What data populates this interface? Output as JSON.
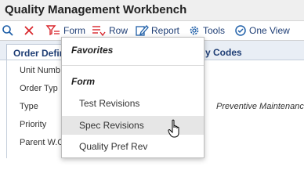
{
  "window": {
    "title": "Quality Management Workbench"
  },
  "toolbar": {
    "search_icon": "search-icon",
    "close_icon": "close-icon",
    "form": {
      "label": "Form",
      "icon": "form-filter-icon"
    },
    "row": {
      "label": "Row",
      "icon": "row-list-icon"
    },
    "report": {
      "label": "Report",
      "icon": "report-edit-icon"
    },
    "tools": {
      "label": "Tools",
      "icon": "gear-icon"
    },
    "oneview": {
      "label": "One View",
      "icon": "one-view-icon"
    }
  },
  "tabs": {
    "active": "Order Defini",
    "other": "y Codes"
  },
  "fields": {
    "unit_number": "Unit Numb",
    "order_type": "Order Typ",
    "type": "Type",
    "priority": "Priority",
    "parent_wo": "Parent W.O",
    "type_value": "Preventive Maintenanc"
  },
  "menu": {
    "favorites": "Favorites",
    "form_section": "Form",
    "items": [
      {
        "label": "Test Revisions"
      },
      {
        "label": "Spec Revisions"
      },
      {
        "label": "Quality Pref Rev"
      }
    ]
  },
  "colors": {
    "accent": "#1f3e75",
    "close": "#d9262c",
    "hover": "#e6e6e6"
  }
}
